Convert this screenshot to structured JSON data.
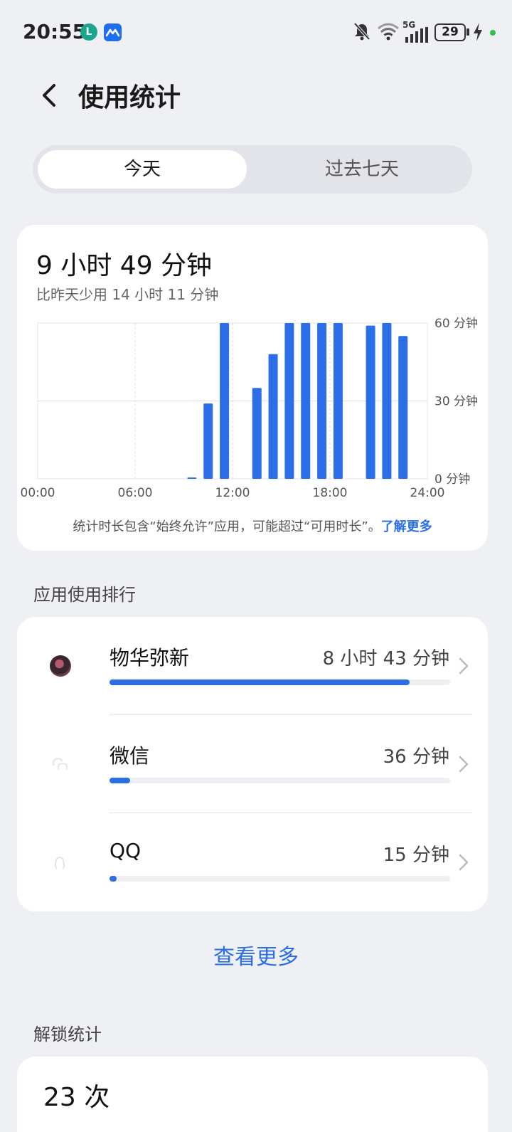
{
  "status_bar": {
    "time": "20:55",
    "network": "5G",
    "battery": "29",
    "notification_icons": [
      "app-l-icon",
      "messenger-icon"
    ],
    "indicator_icons": [
      "silent-icon",
      "wifi-icon",
      "signal-icon",
      "battery-icon",
      "charging-icon"
    ]
  },
  "header": {
    "title": "使用统计"
  },
  "tabs": [
    {
      "label": "今天",
      "active": true
    },
    {
      "label": "过去七天",
      "active": false
    }
  ],
  "usage": {
    "total": "9 小时 49 分钟",
    "compare": "比昨天少用 14 小时 11 分钟",
    "note": "统计时长包含“始终允许”应用，可能超过“可用时长”。",
    "learn_more": "了解更多"
  },
  "chart_data": {
    "type": "bar",
    "x_ticks": [
      "00:00",
      "06:00",
      "12:00",
      "18:00",
      "24:00"
    ],
    "y_ticks": [
      "60 分钟",
      "30 分钟",
      "0 分钟"
    ],
    "ylim": [
      0,
      60
    ],
    "categories": [
      "00:00",
      "01:00",
      "02:00",
      "03:00",
      "04:00",
      "05:00",
      "06:00",
      "07:00",
      "08:00",
      "09:00",
      "10:00",
      "11:00",
      "12:00",
      "13:00",
      "14:00",
      "15:00",
      "16:00",
      "17:00",
      "18:00",
      "19:00",
      "20:00",
      "21:00",
      "22:00",
      "23:00"
    ],
    "values": [
      0,
      0,
      0,
      0,
      0,
      0,
      0,
      0,
      0,
      0.5,
      29,
      60,
      0,
      35,
      48,
      60,
      60,
      60,
      60,
      0,
      59,
      60,
      55,
      0
    ],
    "color": "#2a6ee8"
  },
  "ranking": {
    "section_title": "应用使用排行",
    "items": [
      {
        "name": "物华弥新",
        "time": "8 小时 43 分钟",
        "fraction": 0.88
      },
      {
        "name": "微信",
        "time": "36 分钟",
        "fraction": 0.06
      },
      {
        "name": "QQ",
        "time": "15 分钟",
        "fraction": 0.02
      }
    ],
    "see_more": "查看更多"
  },
  "unlock": {
    "section_title": "解锁统计",
    "count": "23 次"
  },
  "colors": {
    "accent": "#2a6ee8",
    "background": "#eef0f4",
    "card": "#ffffff"
  }
}
